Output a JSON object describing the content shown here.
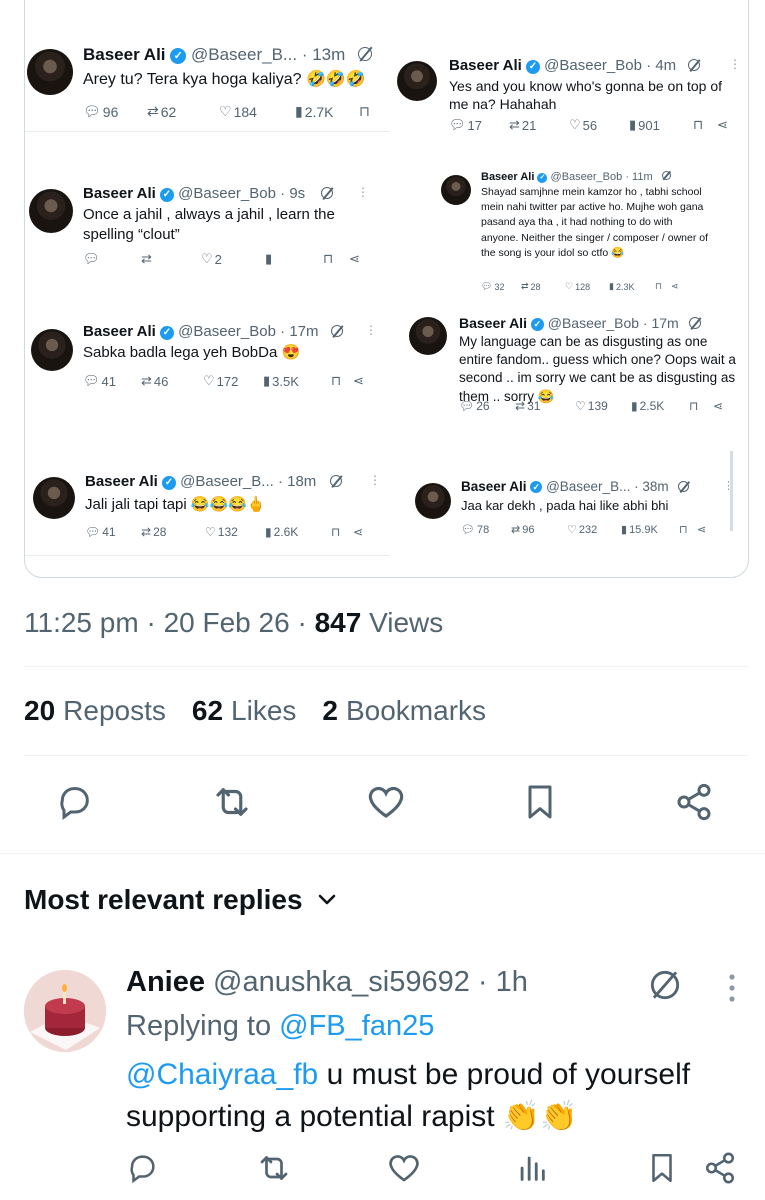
{
  "embedded": {
    "shots": [
      {
        "name": "Baseer Ali",
        "handle": "@Baseer_B...",
        "time": "13m",
        "text": "Arey tu? Tera kya hoga kaliya? 🤣🤣🤣",
        "replies": "96",
        "reposts": "62",
        "likes": "184",
        "views": "2.7K"
      },
      {
        "name": "Baseer Ali",
        "handle": "@Baseer_Bob",
        "time": "4m",
        "text": "Yes and you know who's gonna be on top of me na? Hahahah",
        "replies": "17",
        "reposts": "21",
        "likes": "56",
        "views": "901"
      },
      {
        "name": "Baseer Ali",
        "handle": "@Baseer_Bob",
        "time": "9s",
        "text": "Once a jahil , always a jahil , learn the spelling “clout”",
        "replies": "",
        "reposts": "",
        "likes": "2",
        "views": ""
      },
      {
        "name": "Baseer Ali",
        "handle": "@Baseer_Bob",
        "time": "11m",
        "text": "Shayad samjhne mein kamzor ho , tabhi school mein nahi twitter par active ho. Mujhe woh gana pasand aya tha , it had nothing to do with anyone. Neither the singer / composer / owner of the song is your idol so ctfo 😂",
        "replies": "32",
        "reposts": "28",
        "likes": "128",
        "views": "2.3K"
      },
      {
        "name": "Baseer Ali",
        "handle": "@Baseer_Bob",
        "time": "17m",
        "text": "Sabka badla lega yeh BobDa 😍",
        "replies": "41",
        "reposts": "46",
        "likes": "172",
        "views": "3.5K"
      },
      {
        "name": "Baseer Ali",
        "handle": "@Baseer_Bob",
        "time": "17m",
        "text": "My language can be as disgusting as one entire fandom.. guess which one? Oops wait a second .. im sorry we cant be as disgusting as them .. sorry 😂",
        "replies": "26",
        "reposts": "31",
        "likes": "139",
        "views": "2.5K"
      },
      {
        "name": "Baseer Ali",
        "handle": "@Baseer_B...",
        "time": "18m",
        "text": "Jali jali tapi tapi 😂😂😂🖕",
        "replies": "41",
        "reposts": "28",
        "likes": "132",
        "views": "2.6K"
      },
      {
        "name": "Baseer Ali",
        "handle": "@Baseer_B...",
        "time": "38m",
        "text": "Jaa kar dekh , pada hai like abhi bhi",
        "replies": "78",
        "reposts": "96",
        "likes": "232",
        "views": "15.9K"
      }
    ]
  },
  "tweet_meta": {
    "time": "11:25 pm",
    "date": "20 Feb 26",
    "views_count": "847",
    "views_label": "Views"
  },
  "counts": {
    "reposts_count": "20",
    "reposts_label": "Reposts",
    "likes_count": "62",
    "likes_label": "Likes",
    "bookmarks_count": "2",
    "bookmarks_label": "Bookmarks"
  },
  "replies_section": {
    "title": "Most relevant replies"
  },
  "reply": {
    "name": "Aniee",
    "handle": "@anushka_si59692",
    "time": "1h",
    "replying_prefix": "Replying to",
    "replying_to": "@FB_fan25",
    "mention": "@Chaiyraa_fb",
    "text": "u must be proud of yourself supporting a potential rapist 👏👏"
  },
  "colors": {
    "accent": "#1d9bf0",
    "text": "#0f1419",
    "muted": "#536471",
    "border": "#eff3f4"
  }
}
